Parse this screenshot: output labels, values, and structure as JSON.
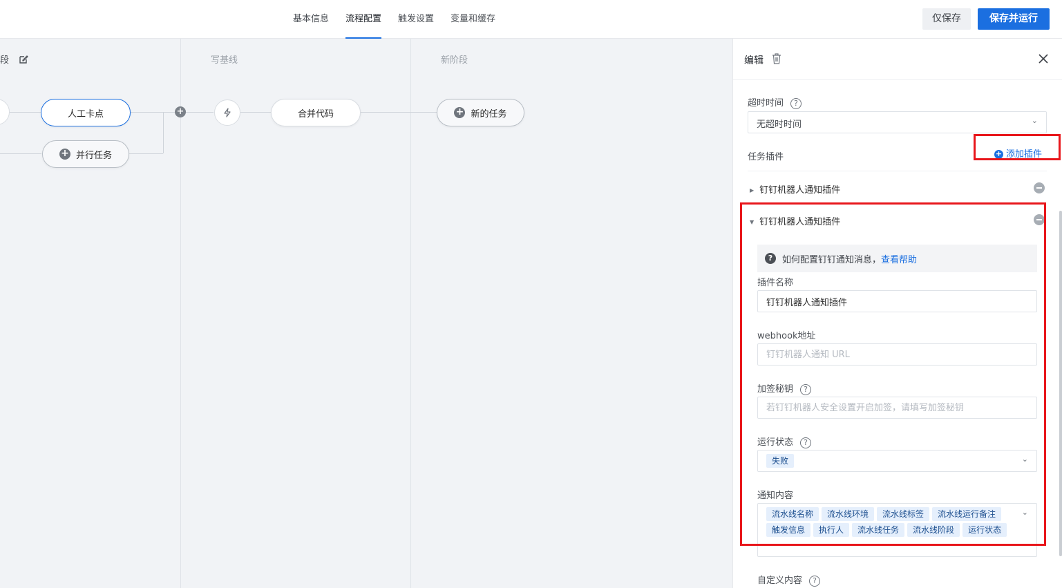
{
  "topbar": {
    "tabs": [
      {
        "label": "基本信息"
      },
      {
        "label": "流程配置"
      },
      {
        "label": "触发设置"
      },
      {
        "label": "变量和缓存"
      }
    ],
    "active_tab": "流程配置",
    "save_only_label": "仅保存",
    "save_run_label": "保存并运行"
  },
  "canvas": {
    "stages": [
      {
        "title": "段"
      },
      {
        "title": "写基线"
      },
      {
        "title": "新阶段"
      }
    ],
    "nodes": {
      "manual_checkpoint": "人工卡点",
      "parallel_task": "并行任务",
      "merge_code": "合并代码",
      "new_task": "新的任务"
    }
  },
  "panel": {
    "title": "编辑",
    "timeout": {
      "label": "超时时间",
      "value": "无超时时间"
    },
    "plugins_label": "任务插件",
    "add_plugin_label": "添加插件",
    "plugins": [
      {
        "name": "钉钉机器人通知插件",
        "expanded": false
      },
      {
        "name": "钉钉机器人通知插件",
        "expanded": true
      }
    ],
    "help": {
      "text": "如何配置钉钉通知消息，",
      "link": "查看帮助"
    },
    "plugin_name": {
      "label": "插件名称",
      "value": "钉钉机器人通知插件"
    },
    "webhook": {
      "label": "webhook地址",
      "placeholder": "钉钉机器人通知 URL"
    },
    "secret": {
      "label": "加签秘钥",
      "placeholder": "若钉钉机器人安全设置开启加签，请填写加签秘钥"
    },
    "run_status": {
      "label": "运行状态",
      "value": "失败"
    },
    "notify_content": {
      "label": "通知内容",
      "tags": [
        "流水线名称",
        "流水线环境",
        "流水线标签",
        "流水线运行备注",
        "触发信息",
        "执行人",
        "流水线任务",
        "流水线阶段",
        "运行状态"
      ]
    },
    "custom_content_label": "自定义内容"
  },
  "colors": {
    "accent": "#1b6fe0",
    "highlight_box": "#e8161b",
    "tag_bg": "#e5effc"
  }
}
